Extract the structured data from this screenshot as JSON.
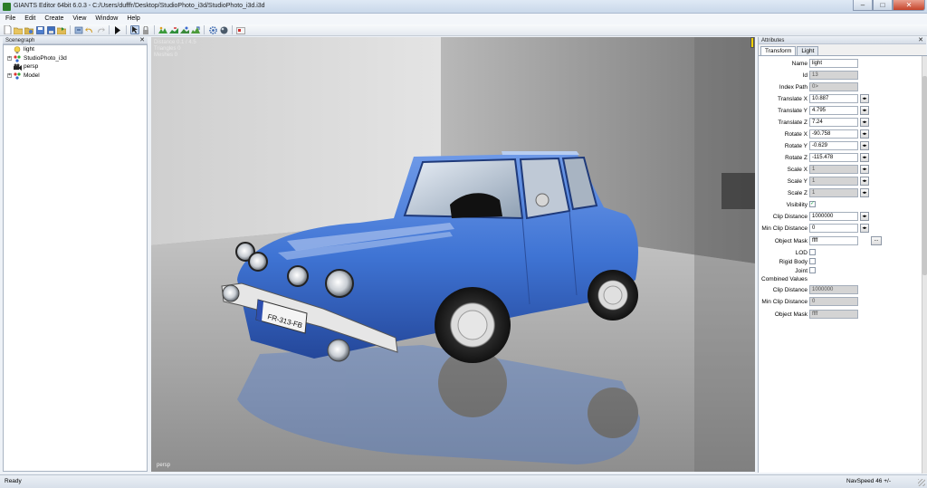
{
  "window": {
    "title": "GIANTS Editor 64bit 6.0.3 - C:/Users/dufffr/Desktop/StudioPhoto_i3d/StudioPhoto_i3d.i3d",
    "minimize": "–",
    "maximize": "□",
    "close": "✕"
  },
  "menu": [
    "File",
    "Edit",
    "Create",
    "View",
    "Window",
    "Help"
  ],
  "toolbar": {
    "icons": [
      "new-file-icon",
      "open-folder-icon",
      "open-recent-icon",
      "save-icon",
      "save-as-icon",
      "export-icon",
      "import-icon",
      "undo-icon",
      "redo-icon",
      "play-icon",
      "select-tool-icon",
      "lock-icon",
      "move-tool-icon",
      "rotate-tool-icon",
      "scale-tool-icon",
      "terrain-tool-icon",
      "settings-gear-icon",
      "material-icon",
      "render-icon"
    ]
  },
  "scenegraph": {
    "title": "Scenegraph",
    "close": "✕",
    "items": [
      {
        "label": "light",
        "icon": "light-bulb-icon",
        "expander": ""
      },
      {
        "label": "StudioPhoto_i3d",
        "icon": "transform-group-icon",
        "expander": "+"
      },
      {
        "label": "persp",
        "icon": "camera-icon",
        "expander": ""
      },
      {
        "label": "Model",
        "icon": "transform-group-icon",
        "expander": "+"
      }
    ]
  },
  "viewport": {
    "stats": [
      "Distance 0.1 / 4.5",
      "Triangles 0",
      "Meshes 0"
    ],
    "camera_name": "persp",
    "plate_text": "FR-313-FB"
  },
  "attributes": {
    "title": "Attributes",
    "tabs": [
      {
        "label": "Transform",
        "active": true
      },
      {
        "label": "Light",
        "active": false
      }
    ],
    "fields": [
      {
        "label": "Name",
        "value": "light",
        "readonly": false,
        "spin": false
      },
      {
        "label": "Id",
        "value": "13",
        "readonly": true,
        "spin": false
      },
      {
        "label": "Index Path",
        "value": "0>",
        "readonly": true,
        "spin": false
      },
      {
        "label": "Translate X",
        "value": "10.887",
        "readonly": false,
        "spin": true
      },
      {
        "label": "Translate Y",
        "value": "4.795",
        "readonly": false,
        "spin": true
      },
      {
        "label": "Translate Z",
        "value": "7.24",
        "readonly": false,
        "spin": true
      },
      {
        "label": "Rotate X",
        "value": "-90.758",
        "readonly": false,
        "spin": true
      },
      {
        "label": "Rotate Y",
        "value": "-0.629",
        "readonly": false,
        "spin": true
      },
      {
        "label": "Rotate Z",
        "value": "-115.478",
        "readonly": false,
        "spin": true
      },
      {
        "label": "Scale X",
        "value": "1",
        "readonly": true,
        "spin": true
      },
      {
        "label": "Scale Y",
        "value": "1",
        "readonly": true,
        "spin": true
      },
      {
        "label": "Scale Z",
        "value": "1",
        "readonly": true,
        "spin": true
      }
    ],
    "visibility": {
      "label": "Visibility",
      "checked": true
    },
    "clip_distance": {
      "label": "Clip Distance",
      "value": "1000000"
    },
    "min_clip_distance": {
      "label": "Min Clip Distance",
      "value": "0"
    },
    "object_mask": {
      "label": "Object Mask",
      "value": "ffff",
      "browse": "..."
    },
    "lod": {
      "label": "LOD"
    },
    "rigid_body": {
      "label": "Rigid Body"
    },
    "joint": {
      "label": "Joint"
    },
    "combined_title": "Combined Values",
    "combined": [
      {
        "label": "Clip Distance",
        "value": "1000000"
      },
      {
        "label": "Min Clip Distance",
        "value": "0"
      },
      {
        "label": "Object Mask",
        "value": "ffff"
      }
    ]
  },
  "status": {
    "left": "Ready",
    "right": "NavSpeed 46 +/-"
  },
  "colors": {
    "car_body": "#3f74d4",
    "viewport_floor": "#9a9a9a",
    "accent_marker": "#f0d000"
  }
}
